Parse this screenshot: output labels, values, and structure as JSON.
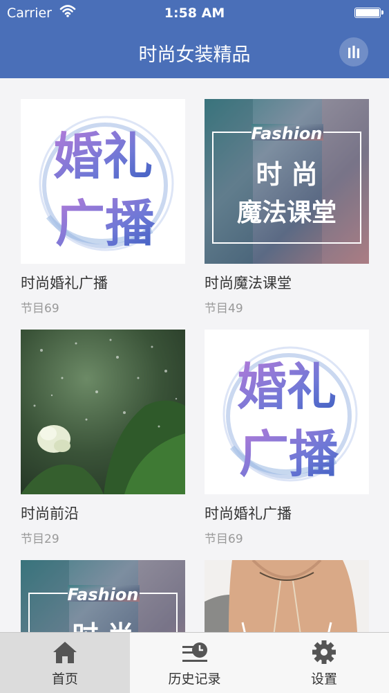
{
  "status_bar": {
    "carrier": "Carrier",
    "time": "1:58 AM"
  },
  "nav": {
    "title": "时尚女装精品",
    "right_icon": "equalizer-icon"
  },
  "thumb_text": {
    "wedding_line1": "婚礼",
    "wedding_line2": "广播",
    "fashion_script": "Fashion",
    "magic_line1": "时 尚",
    "magic_line2": "魔法课堂"
  },
  "items": [
    {
      "title": "时尚婚礼广播",
      "prefix": "节目",
      "count": "69"
    },
    {
      "title": "时尚魔法课堂",
      "prefix": "节目",
      "count": "49"
    },
    {
      "title": "时尚前沿",
      "prefix": "节目",
      "count": "29"
    },
    {
      "title": "时尚婚礼广播",
      "prefix": "节目",
      "count": "69"
    }
  ],
  "tabs": [
    {
      "label": "首页",
      "icon": "home-icon",
      "active": true
    },
    {
      "label": "历史记录",
      "icon": "history-icon",
      "active": false
    },
    {
      "label": "设置",
      "icon": "gear-icon",
      "active": false
    }
  ],
  "colors": {
    "nav_bg": "#4a6fb8",
    "tab_active_bg": "#dcdcdc"
  }
}
